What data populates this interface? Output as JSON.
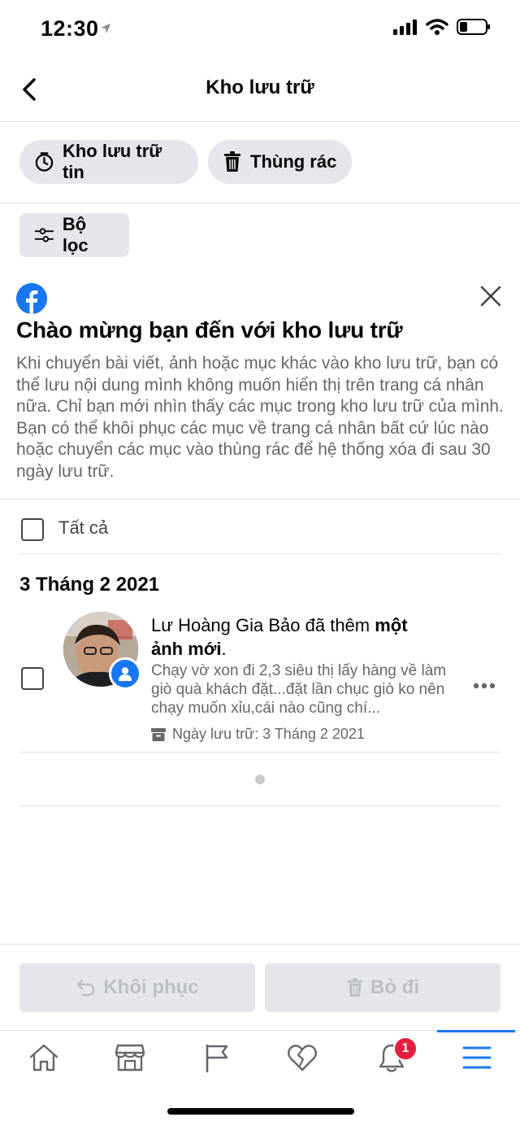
{
  "status_bar": {
    "time": "12:30"
  },
  "header": {
    "title": "Kho lưu trữ"
  },
  "pills": {
    "story_archive": "Kho lưu trữ tin",
    "trash": "Thùng rác"
  },
  "filter": {
    "label": "Bộ lọc"
  },
  "welcome": {
    "title": "Chào mừng bạn đến với kho lưu trữ",
    "body": "Khi chuyển bài viết, ảnh hoặc mục khác vào kho lưu trữ, bạn có thể lưu nội dung mình không muốn hiển thị trên trang cá nhân nữa. Chỉ bạn mới nhìn thấy các mục trong kho lưu trữ của mình. Bạn có thể khôi phục các mục về trang cá nhân bất cứ lúc nào hoặc chuyển các mục vào thùng rác để hệ thống xóa đi sau 30 ngày lưu trữ."
  },
  "select_all": {
    "label": "Tất cả"
  },
  "sections": [
    {
      "date": "3 Tháng 2 2021",
      "items": [
        {
          "title_prefix": "Lư Hoàng Gia Bảo đã thêm ",
          "title_bold": "một ảnh mới",
          "title_suffix": ".",
          "snippet": "Chạy vờ xon đi 2,3 siêu thị lấy hàng về làm giò quà khách đặt...đặt lần chục giò ko nên chạy muốn xỉu,cái nào cũng chí...",
          "archived_date": "Ngày lưu trữ: 3 Tháng 2 2021"
        }
      ]
    }
  ],
  "actions": {
    "restore": "Khôi phục",
    "discard": "Bỏ đi"
  },
  "tabbar": {
    "notifications_count": "1",
    "accent": "#1877f2"
  }
}
